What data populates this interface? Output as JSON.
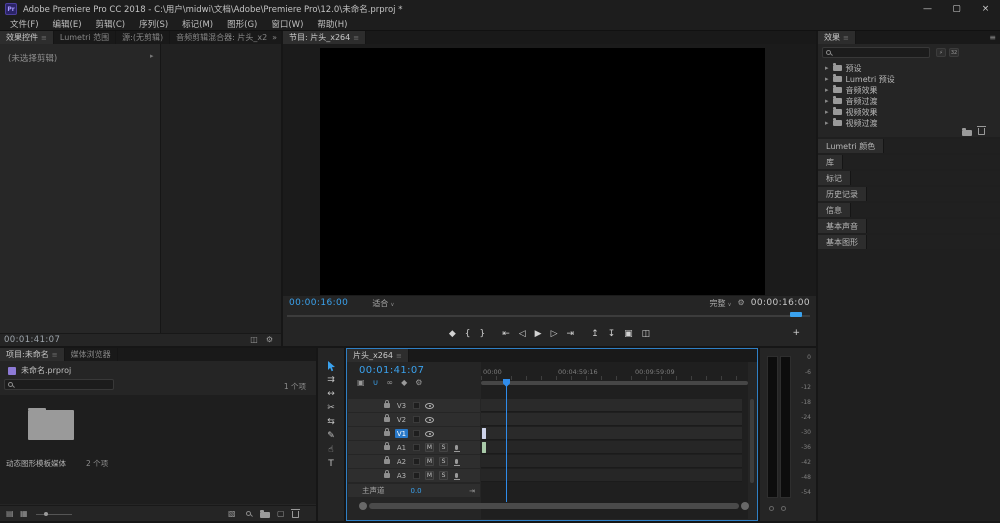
{
  "titlebar": {
    "app_icon_label": "Pr",
    "title": "Adobe Premiere Pro CC 2018 - C:\\用户\\midwi\\文档\\Adobe\\Premiere Pro\\12.0\\未命名.prproj *",
    "minimize": "—",
    "maximize": "▢",
    "close": "×"
  },
  "menubar": {
    "items": [
      "文件(F)",
      "编辑(E)",
      "剪辑(C)",
      "序列(S)",
      "标记(M)",
      "图形(G)",
      "窗口(W)",
      "帮助(H)"
    ]
  },
  "glyphs": {
    "hamburger": "≡",
    "dropdown_caret": "∨",
    "tree_chevron": "▸",
    "overflow": "»"
  },
  "effect_controls": {
    "tab_active": "效果控件",
    "tab_lumetri_scopes": "Lumetri 范围",
    "tab_source": "源:(无剪辑)",
    "tab_audio_clip_mixer": "音频剪辑混合器: 片头_x2",
    "empty_message": "(未选择剪辑)",
    "bottom_timecode": "00:01:41:07",
    "icons": {
      "view_toggle": "◫",
      "settings": "⚙"
    }
  },
  "program_monitor": {
    "tab": "节目: 片头_x264",
    "position_timecode": "00:00:16:00",
    "zoom_level": "适合",
    "playback_resolution": "完整",
    "settings_icon": "⚙",
    "duration_timecode": "00:00:16:00",
    "transport": {
      "add_marker": "◆",
      "mark_in": "{",
      "mark_out": "}",
      "go_to_in": "⇤",
      "step_back": "◁",
      "play": "▶",
      "step_forward": "▷",
      "go_to_out": "⇥",
      "lift": "↥",
      "extract": "↧",
      "export_frame": "▣",
      "comparison_view": "◫",
      "button_editor": "+"
    }
  },
  "effects_panel": {
    "tab": "效果",
    "bins": [
      "预设",
      "Lumetri 预设",
      "音频效果",
      "音频过渡",
      "视频效果",
      "视频过渡"
    ],
    "badges": {
      "accelerated": "⚡",
      "bits32": "32"
    }
  },
  "stacked_panels": [
    "Lumetri 颜色",
    "库",
    "标记",
    "历史记录",
    "信息",
    "基本声音",
    "基本图形"
  ],
  "project_panel": {
    "tab_active": "项目:未命名",
    "tab_media_browser": "媒体浏览器",
    "project_file": "未命名.prproj",
    "item_count": "1 个项",
    "bin_name": "动态图形模板媒体",
    "bin_item_count": "2 个项",
    "icons": {
      "list_view": "▤",
      "icon_view": "▦",
      "automate": "▧",
      "new_item": "▢"
    }
  },
  "tools": {
    "track_select_forward": "⇉",
    "ripple_edit": "↔",
    "razor": "✂",
    "slip": "⇆",
    "pen": "✎",
    "hand": "☝",
    "type": "T"
  },
  "timeline": {
    "tab": "片头_x264",
    "timecode": "00:01:41:07",
    "toolbar": {
      "nest": "▣",
      "snap": "∪",
      "linked_selection": "∞",
      "add_marker": "◆",
      "settings": "⚙"
    },
    "ruler_labels": [
      "00:00",
      "00:04:59:16",
      "00:09:59:09"
    ],
    "video_tracks": [
      "V3",
      "V2",
      "V1"
    ],
    "audio_tracks": [
      "A1",
      "A2",
      "A3"
    ],
    "mute_label": "M",
    "solo_label": "S",
    "master_track": "主声道",
    "master_level": "0.0",
    "keyframe_nav": "⇥"
  },
  "audio_meters": {
    "db_labels": [
      "0",
      "-6",
      "-12",
      "-18",
      "-24",
      "-30",
      "-36",
      "-42",
      "-48",
      "-54"
    ]
  },
  "colors": {
    "accent_blue": "#2f8ceb",
    "timecode_blue": "#3aa2ee",
    "panel_bg": "#252525",
    "focus_border": "#2f7fc4"
  }
}
